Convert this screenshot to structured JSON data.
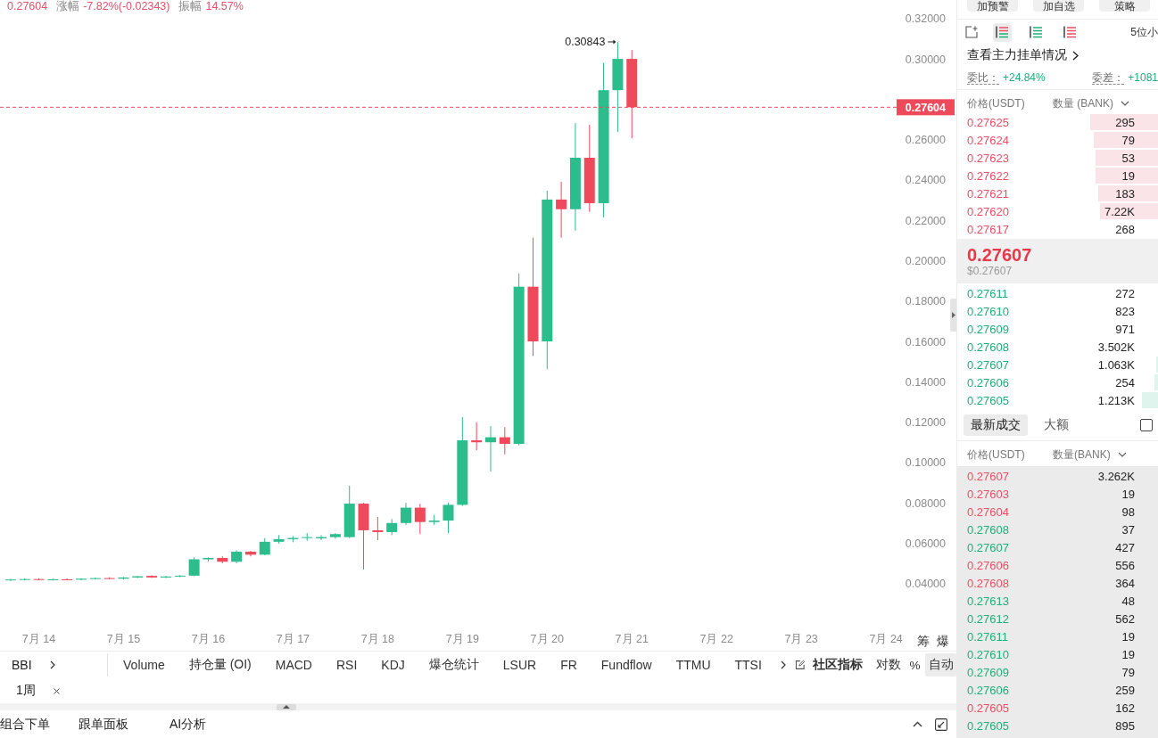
{
  "header": {
    "stats": [
      {
        "value": "0.27604"
      },
      {
        "label": "涨幅",
        "value": "-7.82%(-0.02343)"
      },
      {
        "label": "振幅",
        "value": "14.57%"
      }
    ]
  },
  "chart": {
    "chart_data": [
      {
        "type": "candlestick",
        "x": [
          "--07-13T16:00",
          "--07-13T20:00",
          "--07-14T00:00",
          "--07-14T04:00",
          "--07-14T08:00",
          "--07-14T12:00",
          "--07-14T16:00",
          "--07-14T20:00",
          "--07-15T00:00",
          "--07-15T04:00",
          "--07-15T08:00",
          "--07-15T12:00",
          "--07-15T16:00",
          "--07-15T20:00",
          "--07-16T00:00",
          "--07-16T04:00",
          "--07-16T08:00",
          "--07-16T12:00",
          "--07-16T16:00",
          "--07-16T20:00",
          "--07-17T00:00",
          "--07-17T04:00",
          "--07-17T08:00",
          "--07-17T12:00",
          "--07-17T16:00",
          "--07-17T20:00",
          "--07-18T00:00",
          "--07-18T04:00",
          "--07-18T08:00",
          "--07-18T12:00",
          "--07-18T16:00",
          "--07-18T20:00",
          "--07-19T00:00",
          "--07-19T04:00",
          "--07-19T08:00",
          "--07-19T12:00",
          "--07-19T16:00",
          "--07-19T20:00",
          "--07-20T00:00",
          "--07-20T04:00",
          "--07-20T08:00",
          "--07-20T12:00",
          "--07-20T16:00",
          "--07-20T20:00",
          "--07-21T00:00"
        ],
        "ohlc": [
          [
            0.0418,
            0.0423,
            0.0413,
            0.042
          ],
          [
            0.042,
            0.0425,
            0.0416,
            0.0422
          ],
          [
            0.0422,
            0.0426,
            0.0417,
            0.0419
          ],
          [
            0.0419,
            0.0424,
            0.0415,
            0.0421
          ],
          [
            0.0421,
            0.0425,
            0.0417,
            0.0419
          ],
          [
            0.0419,
            0.0426,
            0.0416,
            0.0424
          ],
          [
            0.0424,
            0.043,
            0.042,
            0.0427
          ],
          [
            0.0427,
            0.0431,
            0.0422,
            0.0424
          ],
          [
            0.0424,
            0.0432,
            0.042,
            0.043
          ],
          [
            0.043,
            0.0437,
            0.0427,
            0.0436
          ],
          [
            0.0438,
            0.0441,
            0.0428,
            0.043
          ],
          [
            0.043,
            0.0438,
            0.0427,
            0.0435
          ],
          [
            0.0435,
            0.0442,
            0.0431,
            0.0439
          ],
          [
            0.0439,
            0.053,
            0.0436,
            0.052
          ],
          [
            0.052,
            0.053,
            0.0508,
            0.0527
          ],
          [
            0.0527,
            0.0535,
            0.05,
            0.0508
          ],
          [
            0.0508,
            0.0565,
            0.05,
            0.0558
          ],
          [
            0.0558,
            0.0562,
            0.0535,
            0.0543
          ],
          [
            0.0543,
            0.0625,
            0.054,
            0.0607
          ],
          [
            0.0607,
            0.064,
            0.0598,
            0.062
          ],
          [
            0.062,
            0.0635,
            0.0605,
            0.0626
          ],
          [
            0.0626,
            0.065,
            0.0612,
            0.063
          ],
          [
            0.0624,
            0.064,
            0.0615,
            0.063
          ],
          [
            0.063,
            0.065,
            0.0622,
            0.0645
          ],
          [
            0.063,
            0.0885,
            0.0625,
            0.0796
          ],
          [
            0.0796,
            0.08,
            0.047,
            0.0664
          ],
          [
            0.0664,
            0.073,
            0.0615,
            0.0655
          ],
          [
            0.0655,
            0.072,
            0.064,
            0.07
          ],
          [
            0.07,
            0.08,
            0.069,
            0.0776
          ],
          [
            0.0776,
            0.0795,
            0.0645,
            0.0705
          ],
          [
            0.0705,
            0.074,
            0.069,
            0.0712
          ],
          [
            0.0712,
            0.08,
            0.065,
            0.079
          ],
          [
            0.079,
            0.1225,
            0.0785,
            0.111
          ],
          [
            0.111,
            0.12,
            0.106,
            0.11
          ],
          [
            0.11,
            0.118,
            0.0955,
            0.1125
          ],
          [
            0.1125,
            0.1175,
            0.104,
            0.1092
          ],
          [
            0.1092,
            0.1937,
            0.1085,
            0.1871
          ],
          [
            0.1871,
            0.2114,
            0.1528,
            0.16
          ],
          [
            0.16,
            0.2347,
            0.1462,
            0.2303
          ],
          [
            0.2303,
            0.2391,
            0.2114,
            0.2255
          ],
          [
            0.2255,
            0.2682,
            0.2149,
            0.251
          ],
          [
            0.251,
            0.2673,
            0.2241,
            0.2285
          ],
          [
            0.2285,
            0.2981,
            0.2215,
            0.2845
          ],
          [
            0.2845,
            0.30843,
            0.2638,
            0.3
          ],
          [
            0.3,
            0.3044,
            0.2607,
            0.27604
          ]
        ],
        "xlim": [
          "--07-13T13:00",
          "--07-24T03:00"
        ],
        "ylim": [
          0.04,
          0.32
        ],
        "xticks": [
          {
            "value": "--07-14",
            "label": "7月 14"
          },
          {
            "value": "--07-15",
            "label": "7月 15"
          },
          {
            "value": "--07-16",
            "label": "7月 16"
          },
          {
            "value": "--07-17",
            "label": "7月 17"
          },
          {
            "value": "--07-18",
            "label": "7月 18"
          },
          {
            "value": "--07-19",
            "label": "7月 19"
          },
          {
            "value": "--07-20",
            "label": "7月 20"
          },
          {
            "value": "--07-21",
            "label": "7月 21"
          },
          {
            "value": "--07-22",
            "label": "7月 22"
          },
          {
            "value": "--07-23",
            "label": "7月 23"
          },
          {
            "value": "--07-24",
            "label": "7月 24"
          }
        ],
        "yticks": [
          {
            "value": 0.04,
            "label": "0.04000"
          },
          {
            "value": 0.06,
            "label": "0.06000"
          },
          {
            "value": 0.08,
            "label": "0.08000"
          },
          {
            "value": 0.1,
            "label": "0.10000"
          },
          {
            "value": 0.12,
            "label": "0.12000"
          },
          {
            "value": 0.14,
            "label": "0.14000"
          },
          {
            "value": 0.16,
            "label": "0.16000"
          },
          {
            "value": 0.18,
            "label": "0.18000"
          },
          {
            "value": 0.2,
            "label": "0.20000"
          },
          {
            "value": 0.22,
            "label": "0.22000"
          },
          {
            "value": 0.24,
            "label": "0.24000"
          },
          {
            "value": 0.26,
            "label": "0.26000"
          },
          {
            "value": 0.3,
            "label": "0.30000"
          },
          {
            "value": 0.32,
            "label": "0.32000"
          }
        ],
        "ref_lines": [
          {
            "axis": "y",
            "value": 0.27604,
            "label": "0.27604",
            "color": "#ef4a5b",
            "line_style": "dashed"
          }
        ],
        "annotations": [
          "0.30843"
        ]
      }
    ],
    "side_buttons": [
      "筹",
      "爆"
    ]
  },
  "indicator_bar": {
    "main": "BBI",
    "indicators": [
      "Volume",
      "持仓量 (OI)",
      "MACD",
      "RSI",
      "KDJ",
      "爆仓统计",
      "LSUR",
      "FR",
      "Fundflow",
      "TTMU",
      "TTSI"
    ],
    "community": "社区指标",
    "scale_modes": [
      {
        "label": "对数",
        "selected": false
      },
      {
        "label": "%",
        "selected": false
      },
      {
        "label": "自动",
        "selected": true
      }
    ]
  },
  "interval_tag": {
    "label": "1周"
  },
  "bottom_tabs": [
    "组合下单",
    "跟单面板",
    "AI分析"
  ],
  "right_panel": {
    "actions": [
      "加预警",
      "加自选",
      "策略"
    ],
    "book_views": [
      {
        "kind": "both",
        "selected": true
      },
      {
        "kind": "bids",
        "selected": false
      },
      {
        "kind": "asks",
        "selected": false
      }
    ],
    "decimals": "5位小",
    "big_orders_link": "查看主力挂单情况",
    "ratio": {
      "label": "委比：",
      "value": "+24.84%"
    },
    "diff": {
      "label": "委差：",
      "value": "+1081"
    },
    "order_book": {
      "columns": [
        "价格(USDT)",
        "数量 (BANK)"
      ],
      "asks": [
        {
          "price": "0.27625",
          "amount": "295",
          "level": 0.34
        },
        {
          "price": "0.27624",
          "amount": "79",
          "level": 0.32
        },
        {
          "price": "0.27623",
          "amount": "53",
          "level": 0.31
        },
        {
          "price": "0.27622",
          "amount": "19",
          "level": 0.31
        },
        {
          "price": "0.27621",
          "amount": "183",
          "level": 0.3
        },
        {
          "price": "0.27620",
          "amount": "7.22K",
          "level": 0.29
        },
        {
          "price": "0.27617",
          "amount": "268"
        }
      ],
      "last_price": "0.27607",
      "last_price_usd": "$0.27607",
      "bids": [
        {
          "price": "0.27611",
          "amount": "272"
        },
        {
          "price": "0.27610",
          "amount": "823"
        },
        {
          "price": "0.27609",
          "amount": "971"
        },
        {
          "price": "0.27608",
          "amount": "3.502K"
        },
        {
          "price": "0.27607",
          "amount": "1.063K",
          "level": 0.01
        },
        {
          "price": "0.27606",
          "amount": "254",
          "level": 0.02
        },
        {
          "price": "0.27605",
          "amount": "1.213K",
          "level": 0.08
        }
      ]
    },
    "trades": {
      "tabs": [
        {
          "label": "最新成交",
          "selected": true
        },
        {
          "label": "大额",
          "selected": false
        }
      ],
      "filter_checked": false,
      "columns": [
        "价格(USDT)",
        "数量(BANK)"
      ],
      "rows": [
        {
          "price": "0.27607",
          "amount": "3.262K",
          "color": "#e84f63"
        },
        {
          "price": "0.27603",
          "amount": "19",
          "color": "#e84f63"
        },
        {
          "price": "0.27604",
          "amount": "98",
          "color": "#e84f63"
        },
        {
          "price": "0.27608",
          "amount": "37",
          "color": "#1fae7a"
        },
        {
          "price": "0.27607",
          "amount": "427",
          "color": "#1fae7a"
        },
        {
          "price": "0.27606",
          "amount": "556",
          "color": "#e84f63"
        },
        {
          "price": "0.27608",
          "amount": "364",
          "color": "#e84f63"
        },
        {
          "price": "0.27613",
          "amount": "48",
          "color": "#1fae7a"
        },
        {
          "price": "0.27612",
          "amount": "562",
          "color": "#1fae7a"
        },
        {
          "price": "0.27611",
          "amount": "19",
          "color": "#1fae7a"
        },
        {
          "price": "0.27610",
          "amount": "19",
          "color": "#1fae7a"
        },
        {
          "price": "0.27609",
          "amount": "79",
          "color": "#1fae7a"
        },
        {
          "price": "0.27606",
          "amount": "259",
          "color": "#1fae7a"
        },
        {
          "price": "0.27605",
          "amount": "162",
          "color": "#e84f63"
        },
        {
          "price": "0.27605",
          "amount": "895",
          "color": "#1fae7a"
        }
      ]
    }
  }
}
